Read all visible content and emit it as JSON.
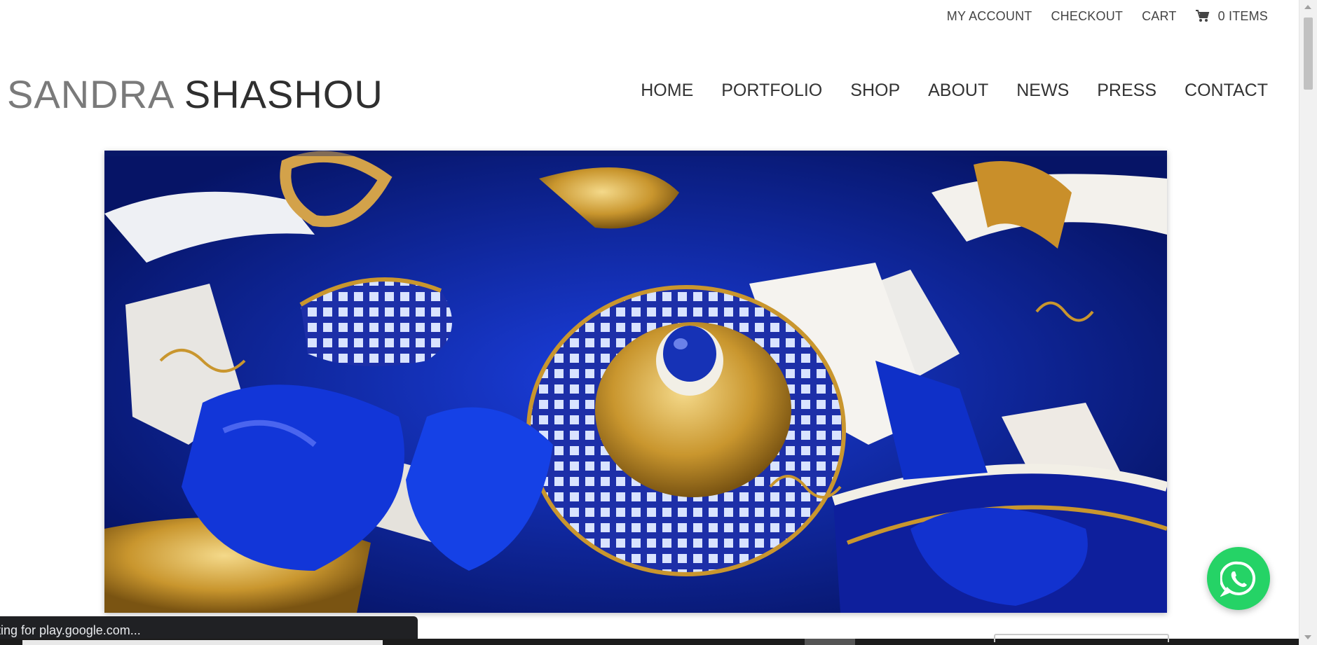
{
  "top_links": {
    "my_account": "MY ACCOUNT",
    "checkout": "CHECKOUT",
    "cart": "CART",
    "items": "0 ITEMS"
  },
  "logo": {
    "first": "SANDRA",
    "last": "SHASHOU"
  },
  "nav": [
    "HOME",
    "PORTFOLIO",
    "SHOP",
    "ABOUT",
    "NEWS",
    "PRESS",
    "CONTACT"
  ],
  "hero": {
    "icon": "hero-image"
  },
  "whatsapp": {
    "icon": "whatsapp-icon",
    "color": "#25d366"
  },
  "status_bar": {
    "text": "ting for play.google.com..."
  },
  "colors": {
    "hero_blue": "#0a2bb8",
    "gold": "#c9962e",
    "status_bg": "#202124"
  }
}
